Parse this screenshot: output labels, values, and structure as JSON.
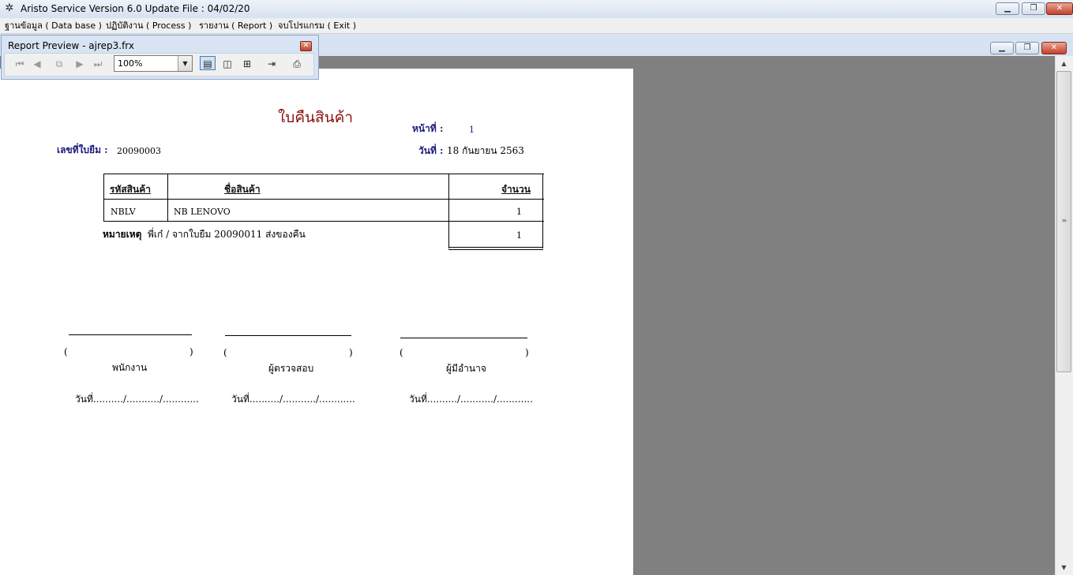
{
  "window": {
    "title": "Aristo Service Version 6.0 Update File : 04/02/20",
    "icon": "app-logo-icon",
    "controls": [
      "minimize-icon",
      "restore-icon",
      "close-icon"
    ]
  },
  "menubar": {
    "items": [
      {
        "label": "ฐานข้อมูล ( Data base )"
      },
      {
        "label": "ปฏิบัติงาน ( Process )"
      },
      {
        "label": "รายงาน ( Report )"
      },
      {
        "label": "จบโปรแกรม ( Exit )"
      }
    ]
  },
  "preview": {
    "title": "Report Preview - ajrep3.frx",
    "zoom": "100%",
    "zoom_options_selected": "100%",
    "tools": [
      "first-page-icon",
      "prev-page-icon",
      "goto-page-icon",
      "next-page-icon",
      "last-page-icon",
      "one-page-icon",
      "two-pages-icon",
      "four-pages-icon",
      "close-preview-icon",
      "print-icon"
    ]
  },
  "report": {
    "title": "ใบคืนสินค้า",
    "page_label": "หน้าที่ :",
    "page_value": "1",
    "doc_no_label": "เลขที่ใบยืม :",
    "doc_no_value": "20090003",
    "date_label": "วันที่ :",
    "date_value": "18 กันยายน 2563",
    "table": {
      "headers": [
        "รหัสสินค้า",
        "ชื่อสินค้า",
        "จำนวน"
      ],
      "rows": [
        {
          "code": "NBLV",
          "name": "NB LENOVO",
          "qty": "1"
        }
      ],
      "total_qty": "1"
    },
    "remark_label": "หมายเหตุ",
    "remark_value": "พี่เก๋ / จากใบยืม 20090011 ส่งของคืน",
    "signatures": [
      {
        "open": "(",
        "close": ")",
        "role": "พนักงาน",
        "date": "วันที่........../.........../............"
      },
      {
        "open": "(",
        "close": ")",
        "role": "ผู้ตรวจสอบ",
        "date": "วันที่........../.........../............"
      },
      {
        "open": "(",
        "close": ")",
        "role": "ผู้มีอำนาจ",
        "date": "วันที่........../.........../............"
      }
    ]
  },
  "colors": {
    "title_red": "#8b0f0f",
    "label_navy": "#1a1a7a",
    "workspace_grey": "#808080"
  }
}
